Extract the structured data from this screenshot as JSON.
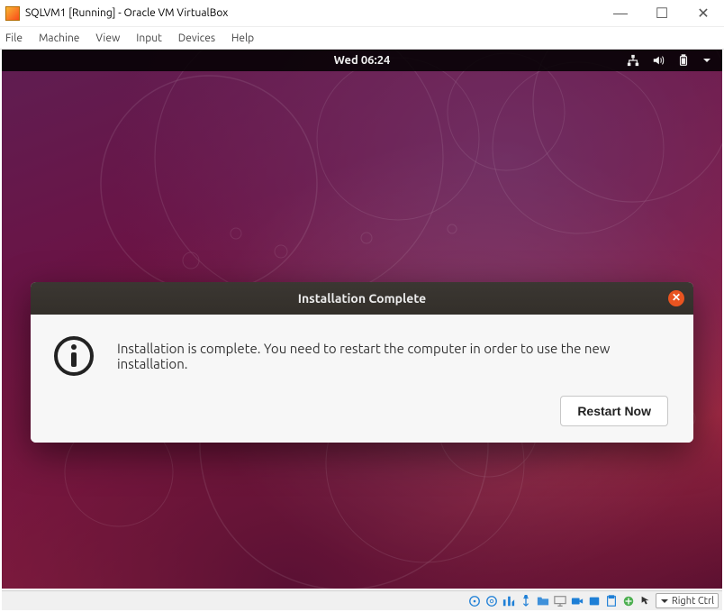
{
  "window": {
    "title": "SQLVM1 [Running] - Oracle VM VirtualBox",
    "controls": {
      "minimize": "—",
      "maximize": "☐",
      "close": "✕"
    }
  },
  "menubar": {
    "items": [
      "File",
      "Machine",
      "View",
      "Input",
      "Devices",
      "Help"
    ]
  },
  "gnome": {
    "clock": "Wed 06:24",
    "status_icons": [
      "network",
      "volume",
      "battery",
      "dropdown"
    ]
  },
  "dialog": {
    "title": "Installation Complete",
    "message": "Installation is complete. You need to restart the computer in order to use the new installation.",
    "close": "✕",
    "restart": "Restart Now"
  },
  "statusbar": {
    "hostkey": "Right Ctrl"
  }
}
